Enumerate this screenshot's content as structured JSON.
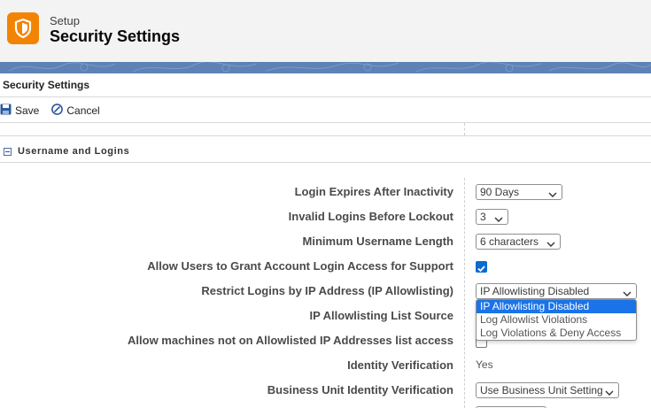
{
  "header": {
    "small_label": "Setup",
    "title": "Security Settings"
  },
  "page": {
    "section_title": "Security Settings"
  },
  "toolbar": {
    "save_label": "Save",
    "cancel_label": "Cancel"
  },
  "section": {
    "title": "Username and Logins"
  },
  "fields": {
    "login_expires": {
      "label": "Login Expires After Inactivity",
      "value": "90 Days"
    },
    "invalid_logins": {
      "label": "Invalid Logins Before Lockout",
      "value": "3"
    },
    "min_username": {
      "label": "Minimum Username Length",
      "value": "6 characters"
    },
    "allow_grant_access": {
      "label": "Allow Users to Grant Account Login Access for Support",
      "checked": true
    },
    "restrict_ip": {
      "label": "Restrict Logins by IP Address (IP Allowlisting)",
      "value": "IP Allowlisting Disabled",
      "options": [
        "IP Allowlisting Disabled",
        "Log Allowlist Violations",
        "Log Violations & Deny Access"
      ]
    },
    "ip_list_source": {
      "label": "IP Allowlisting List Source"
    },
    "allow_machines": {
      "label": "Allow machines not on Allowlisted IP Addresses list access",
      "checked": false
    },
    "identity_verification": {
      "label": "Identity Verification",
      "value": "Yes"
    },
    "bu_identity_verification": {
      "label": "Business Unit Identity Verification",
      "value": "Use Business Unit Setting"
    }
  },
  "colors": {
    "accent": "#f38303",
    "banner": "#5e82b5",
    "checkbox": "#0b6bd0",
    "selected_option": "#1a73e8"
  },
  "icons": {
    "app": "shield-icon",
    "save": "save-icon",
    "cancel": "cancel-icon",
    "section": "collapse-icon",
    "select": "chevron-down-icon"
  }
}
